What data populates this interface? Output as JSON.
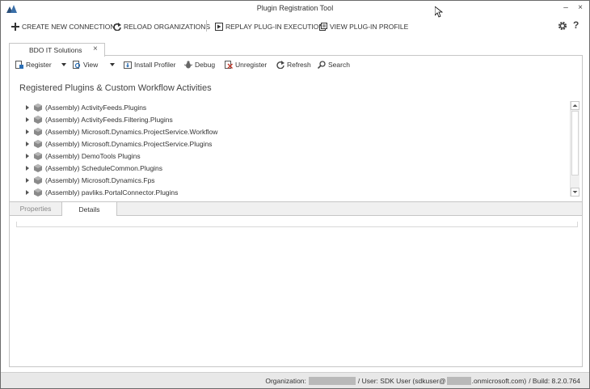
{
  "window": {
    "title": "Plugin Registration Tool",
    "minimize": "–",
    "close": "×"
  },
  "main_toolbar": {
    "create_connection": "CREATE NEW CONNECTION",
    "reload_orgs": "RELOAD ORGANIZATIONS",
    "replay_execution": "REPLAY PLUG-IN EXECUTION",
    "view_profile": "VIEW PLUG-IN PROFILE",
    "help": "?"
  },
  "org_tab": {
    "label": "BDO IT Solutions",
    "close": "×"
  },
  "sub_toolbar": {
    "register": "Register",
    "view": "View",
    "install_profiler": "Install Profiler",
    "debug": "Debug",
    "unregister": "Unregister",
    "refresh": "Refresh",
    "search": "Search"
  },
  "section_title": "Registered Plugins & Custom Workflow Activities",
  "tree_items": [
    "(Assembly) ActivityFeeds.Plugins",
    "(Assembly) ActivityFeeds.Filtering.Plugins",
    "(Assembly) Microsoft.Dynamics.ProjectService.Workflow",
    "(Assembly) Microsoft.Dynamics.ProjectService.Plugins",
    "(Assembly) DemoTools Plugins",
    "(Assembly) ScheduleCommon.Plugins",
    "(Assembly) Microsoft.Dynamics.Fps",
    "(Assembly) pavliks.PortalConnector.Plugins"
  ],
  "bottom_tabs": {
    "properties": "Properties",
    "details": "Details"
  },
  "status": {
    "org_label": "Organization:",
    "user_label": "/ User: SDK User (sdkuser@",
    "domain_suffix": ".onmicrosoft.com)",
    "build": "/ Build: 8.2.0.764"
  },
  "colors": {
    "accent_icon": "#2b6fb6",
    "assembly_icon": "#8a8a8a",
    "redaction": "#b9b9b9"
  }
}
